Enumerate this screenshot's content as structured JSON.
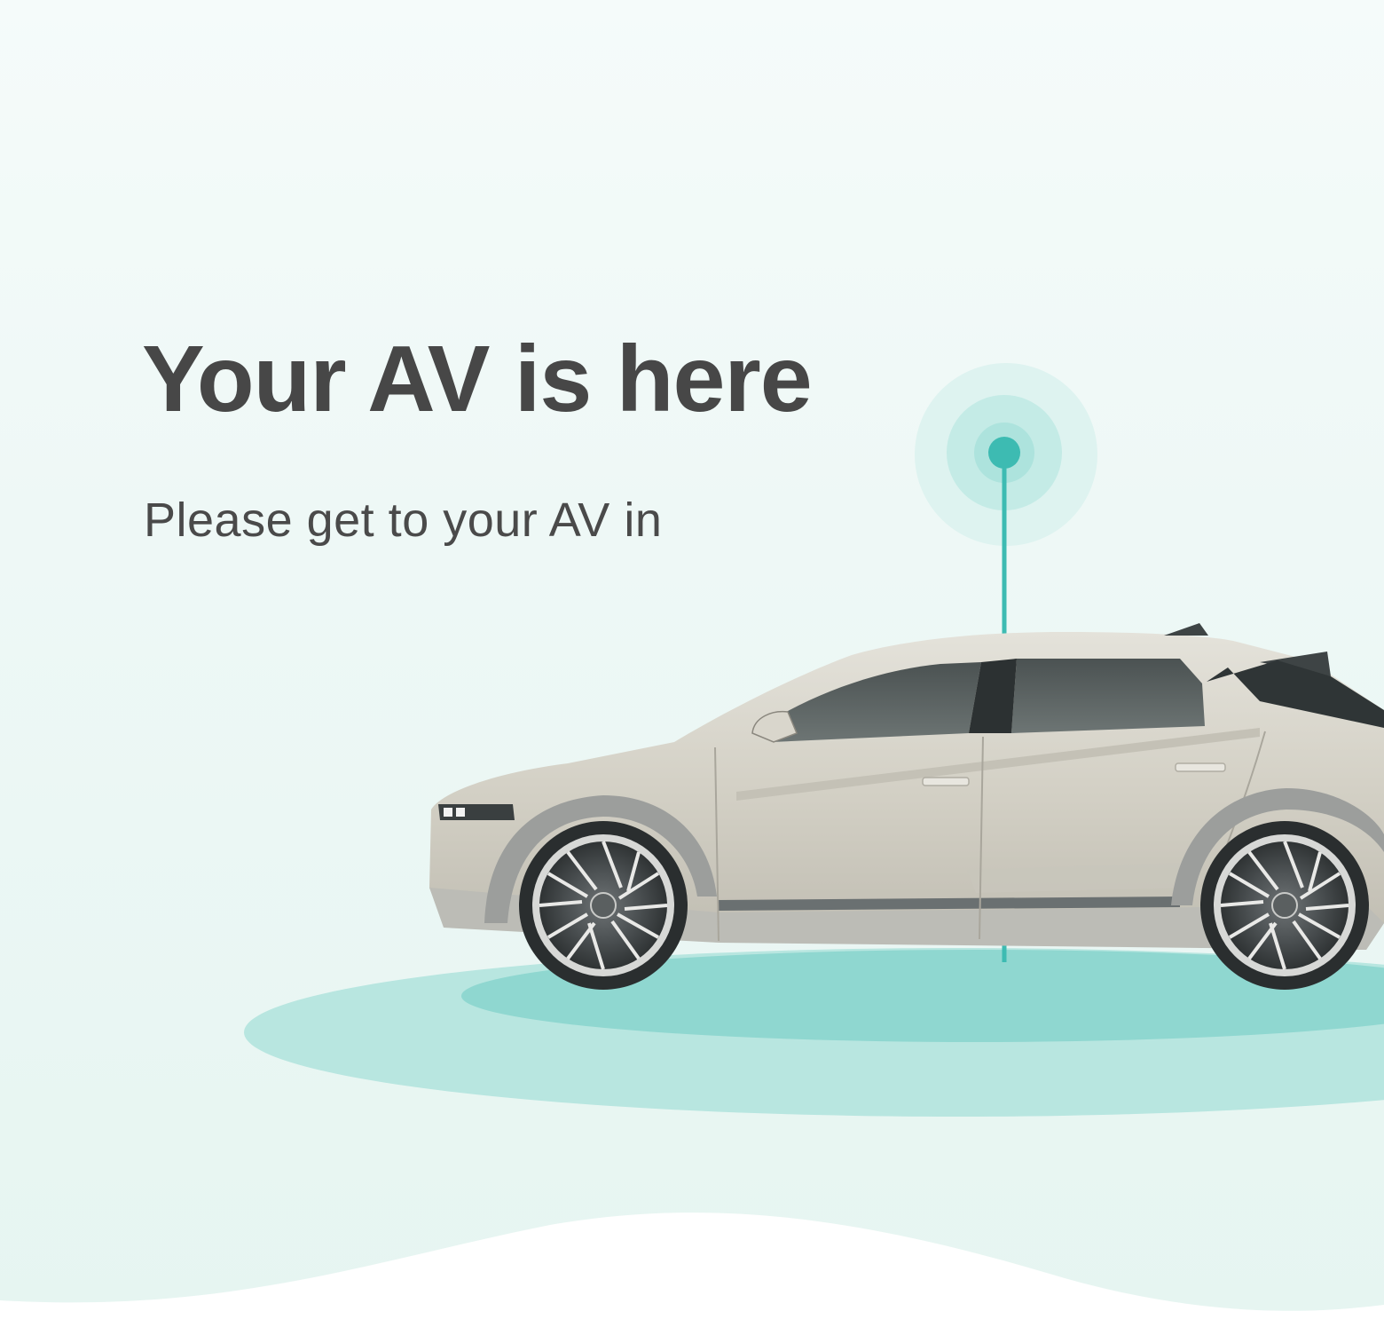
{
  "screen": {
    "title": "Your AV is here",
    "subtitle": "Please get to your AV in",
    "countdown": ""
  },
  "colors": {
    "accent": "#3dbbb2",
    "pulse_outer": "#def3f0",
    "pulse_inner": "#c4ebe6",
    "ground_shadow_light": "#b8e6e0",
    "ground_shadow_dark": "#8fd7d0",
    "car_body": "#d6d3c9",
    "text": "#474747"
  },
  "icons": {
    "location_pin": "location-pulse-icon",
    "vehicle": "car-illustration"
  }
}
